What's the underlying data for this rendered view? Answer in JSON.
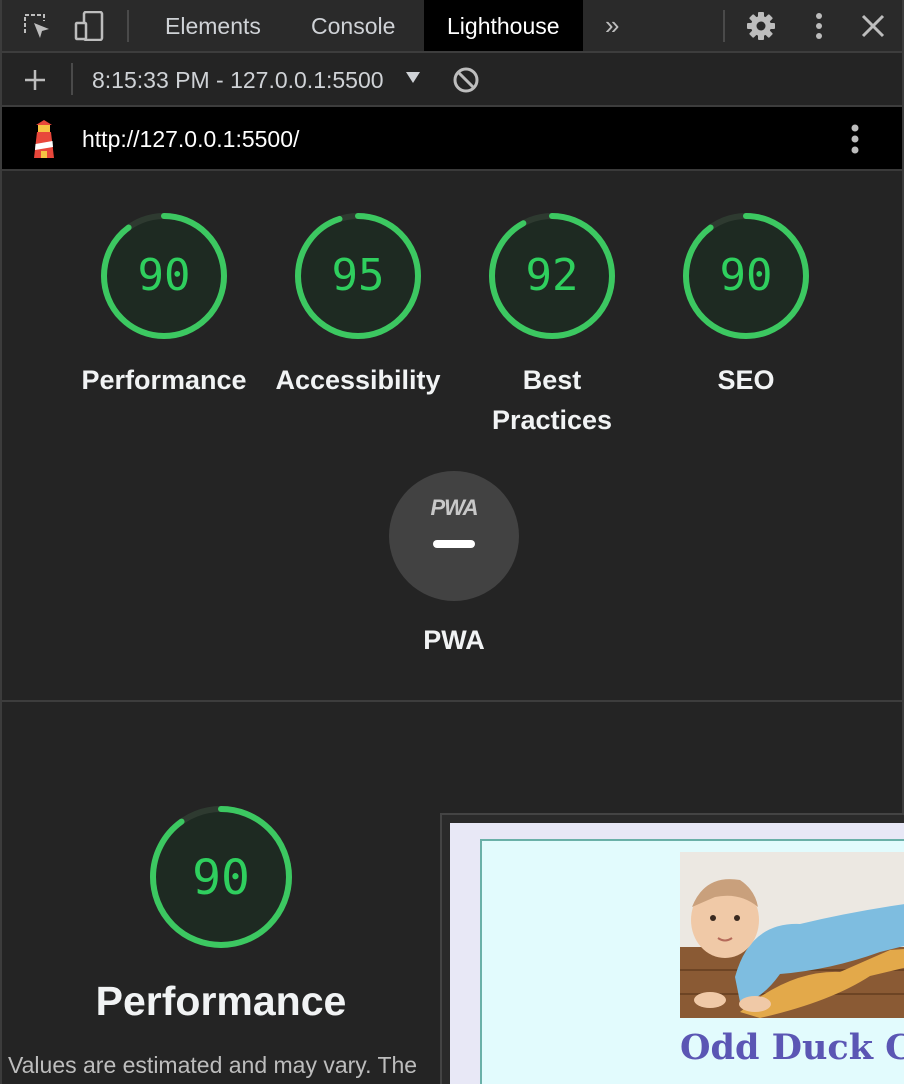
{
  "devtools": {
    "tabs": [
      {
        "label": "Elements"
      },
      {
        "label": "Console"
      },
      {
        "label": "Lighthouse"
      }
    ],
    "active_tab": "Lighthouse",
    "icons": [
      "inspect-element-icon",
      "device-toolbar-icon",
      "more-tabs-icon",
      "gear-icon",
      "kebab-menu-icon",
      "close-icon"
    ]
  },
  "toolbar": {
    "report_selector": "8:15:33 PM - 127.0.0.1:5500",
    "icons": [
      "add-icon",
      "dropdown-caret-icon",
      "clear-icon"
    ]
  },
  "urlbar": {
    "url": "http://127.0.0.1:5500/",
    "icons": [
      "lighthouse-logo-icon",
      "kebab-menu-icon"
    ]
  },
  "scores": [
    {
      "label": "Performance",
      "value": "90"
    },
    {
      "label": "Accessibility",
      "value": "95"
    },
    {
      "label": "Best",
      "label_line2": "Practices",
      "value": "92"
    },
    {
      "label": "SEO",
      "value": "90"
    }
  ],
  "pwa": {
    "badge_text": "PWA",
    "label": "PWA"
  },
  "performance_section": {
    "score": "90",
    "title": "Performance",
    "description": "Values are estimated and may vary. The"
  },
  "preview": {
    "site_title": "Odd Duck Co"
  },
  "colors": {
    "pass_green": "#2fcf5e",
    "gauge_track": "#1e2a22",
    "background": "#242424",
    "preview_title": "#5b56b4"
  }
}
